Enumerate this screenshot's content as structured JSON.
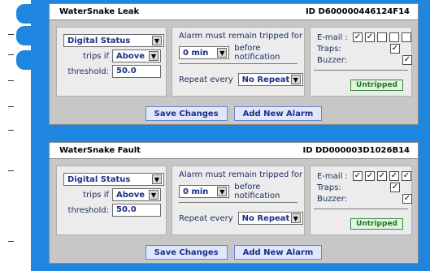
{
  "panels": [
    {
      "title": "WaterSnake Leak",
      "id": "ID D600000446124F14",
      "status_select": "Digital Status",
      "trips_if_label": "trips if",
      "trips_if": "Above",
      "threshold_label": "threshold:",
      "threshold": "50.0",
      "alarm_label": "Alarm must remain tripped for",
      "remain_select": "0 min",
      "before_label": "before notification",
      "repeat_label": "Repeat every",
      "repeat": "No Repeat",
      "email_label": "E-mail :",
      "traps_label": "Traps:",
      "buzzer_label": "Buzzer:",
      "status": "Untripped",
      "save": "Save Changes",
      "add": "Add New Alarm",
      "email_checks": [
        "✓",
        "✓",
        "",
        "",
        ""
      ],
      "traps_check": "✓",
      "buzzer_check": "✓"
    },
    {
      "title": "WaterSnake Fault",
      "id": "ID DD000003D1026B14",
      "status_select": "Digital Status",
      "trips_if_label": "trips if",
      "trips_if": "Above",
      "threshold_label": "threshold:",
      "threshold": "50.0",
      "alarm_label": "Alarm must remain tripped for",
      "remain_select": "0 min",
      "before_label": "before notification",
      "repeat_label": "Repeat every",
      "repeat": "No Repeat",
      "email_label": "E-mail :",
      "traps_label": "Traps:",
      "buzzer_label": "Buzzer:",
      "status": "Untripped",
      "save": "Save Changes",
      "add": "Add New Alarm",
      "email_checks": [
        "✓",
        "✓",
        "✓",
        "✓",
        "✓"
      ],
      "traps_check": "✓",
      "buzzer_check": "✓"
    }
  ],
  "colors": {
    "page": "#1f86df",
    "panel": "#c7c7c7",
    "section": "#ececec",
    "button": "#dfe7fb"
  }
}
